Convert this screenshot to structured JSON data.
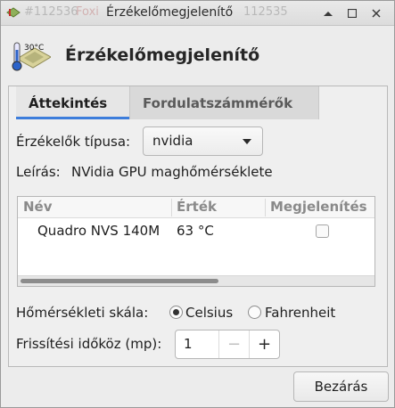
{
  "window": {
    "title": "Érzékelőmegjelenítő",
    "ghost_left": "#112536",
    "ghost_left2": "Foxi",
    "ghost_right": "112535",
    "app_icon": "temperature-sensor-icon"
  },
  "header": {
    "title": "Érzékelőmegjelenítő",
    "icon_text": "30°C",
    "icon": "thermometer-chip-icon"
  },
  "tabs": [
    {
      "label": "Áttekintés",
      "active": true
    },
    {
      "label": "Fordulatszámmérők",
      "active": false
    }
  ],
  "overview": {
    "sensor_type_label": "Érzékelők típusa:",
    "sensor_type_value": "nvidia",
    "description_label": "Leírás:",
    "description_value": "NVidia GPU maghőmérséklete",
    "table": {
      "columns": [
        "Név",
        "Érték",
        "Megjelenítés"
      ],
      "rows": [
        {
          "name": "Quadro NVS 140M",
          "value": "63 °C",
          "show": false
        }
      ]
    },
    "scale_label": "Hőmérsékleti skála:",
    "scale_options": [
      "Celsius",
      "Fahrenheit"
    ],
    "scale_selected": "Celsius",
    "interval_label": "Frissítési időköz (mp):",
    "interval_value": "1",
    "minus": "−",
    "plus": "+"
  },
  "footer": {
    "close_label": "Bezárás"
  },
  "colors": {
    "accent": "#3d7ddb",
    "window_bg": "#ececec"
  }
}
